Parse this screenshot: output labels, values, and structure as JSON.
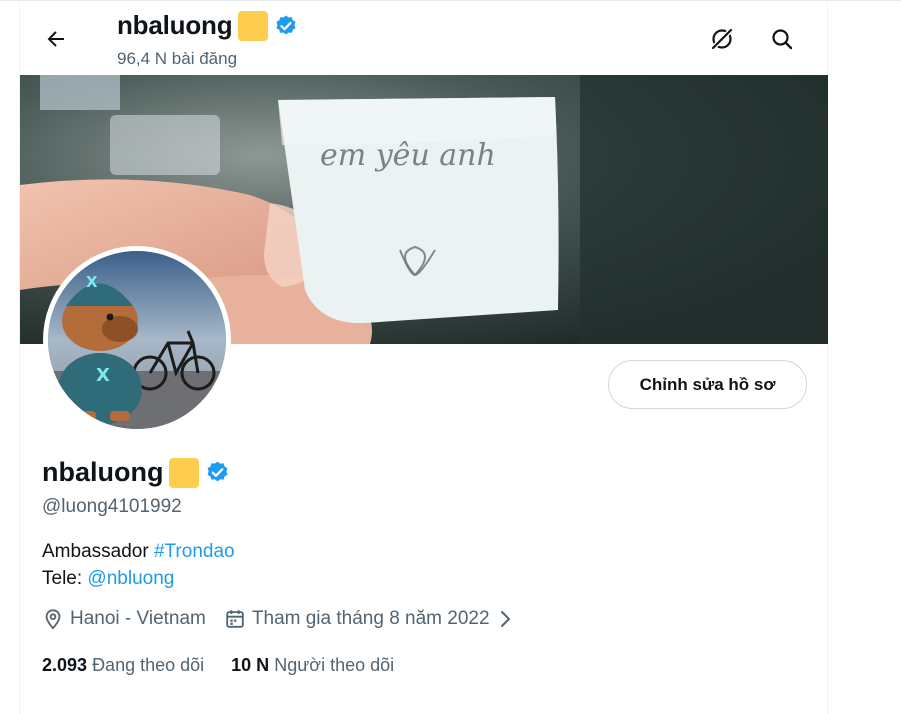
{
  "header": {
    "name": "nbaluong",
    "post_count": "96,4 N bài đăng"
  },
  "profile": {
    "name": "nbaluong",
    "handle": "@luong4101992",
    "edit_button": "Chỉnh sửa hồ sơ",
    "bio": {
      "line1_text": "Ambassador ",
      "line1_tag": "#Trondao",
      "line2_text": "Tele: ",
      "line2_link": "@nbluong"
    },
    "location": "Hanoi - Vietnam",
    "joined": "Tham gia tháng 8 năm 2022",
    "following_count": "2.093",
    "following_label": "Đang theo dõi",
    "followers_count": "10 N",
    "followers_label": "Người theo dõi"
  },
  "banner_note_text": "em yêu anh",
  "icons": {
    "back": "arrow-left-icon",
    "grok": "grok-icon",
    "search": "search-icon",
    "verified": "verified-badge-icon",
    "location": "location-pin-icon",
    "calendar": "calendar-icon",
    "chevron": "chevron-right-icon"
  },
  "colors": {
    "accent": "#1d9bf0",
    "secondary_text": "#536471",
    "gold": "#ffcd4d"
  }
}
